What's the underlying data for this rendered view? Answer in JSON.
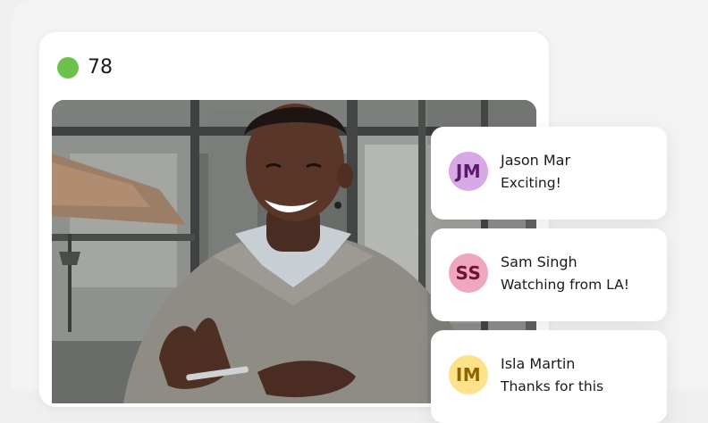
{
  "stream": {
    "viewer_count": "78",
    "live_color": "#6cc24a"
  },
  "video": {
    "description_icon": "video-feed"
  },
  "comments": [
    {
      "initials": "JM",
      "name": "Jason Mar",
      "text": "Exciting!",
      "avatar_bg": "#d9a8e6",
      "avatar_fg": "#5b1a6b"
    },
    {
      "initials": "SS",
      "name": "Sam Singh",
      "text": "Watching from LA!",
      "avatar_bg": "#f0a6bd",
      "avatar_fg": "#6b1433"
    },
    {
      "initials": "IM",
      "name": "Isla Martin",
      "text": "Thanks for this",
      "avatar_bg": "#fde28a",
      "avatar_fg": "#8a6500"
    }
  ]
}
